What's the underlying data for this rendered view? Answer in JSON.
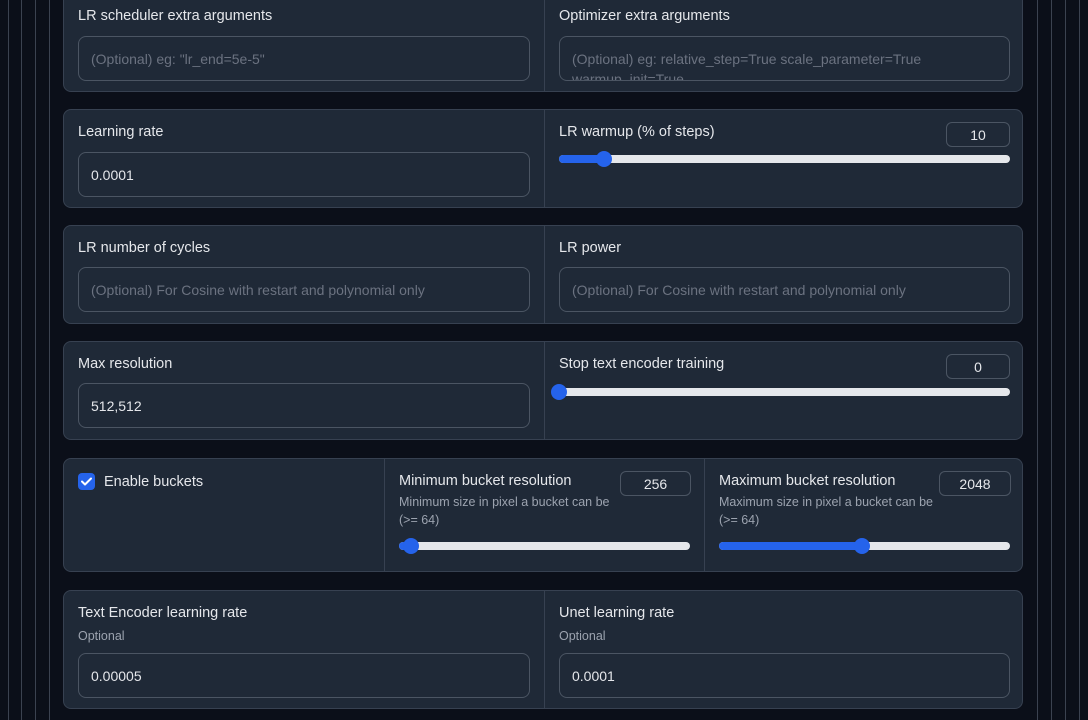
{
  "scheduler_row": {
    "lr_scheduler_args_label": "LR scheduler extra arguments",
    "lr_scheduler_args_placeholder": "(Optional) eg: \"lr_end=5e-5\"",
    "optimizer_args_label": "Optimizer extra arguments",
    "optimizer_args_placeholder": "(Optional) eg: relative_step=True scale_parameter=True warmup_init=True"
  },
  "lr_row": {
    "learning_rate_label": "Learning rate",
    "learning_rate_value": "0.0001",
    "lr_warmup_label": "LR warmup (% of steps)",
    "lr_warmup_value": "10",
    "lr_warmup_fraction": 0.1
  },
  "cycles_row": {
    "lr_cycles_label": "LR number of cycles",
    "lr_cycles_placeholder": "(Optional) For Cosine with restart and polynomial only",
    "lr_power_label": "LR power",
    "lr_power_placeholder": "(Optional) For Cosine with restart and polynomial only"
  },
  "resolution_row": {
    "max_resolution_label": "Max resolution",
    "max_resolution_value": "512,512",
    "stop_text_encoder_label": "Stop text encoder training",
    "stop_text_encoder_value": "0",
    "stop_text_encoder_fraction": 0.0
  },
  "bucket_row": {
    "enable_buckets_label": "Enable buckets",
    "enable_buckets_checked": true,
    "min_bucket_label": "Minimum bucket resolution",
    "min_bucket_info": "Minimum size in pixel a bucket can be (>= 64)",
    "min_bucket_value": "256",
    "min_bucket_fraction": 0.04,
    "max_bucket_label": "Maximum bucket resolution",
    "max_bucket_info": "Maximum size in pixel a bucket can be (>= 64)",
    "max_bucket_value": "2048",
    "max_bucket_fraction": 0.49
  },
  "encoder_row": {
    "text_encoder_lr_label": "Text Encoder learning rate",
    "text_encoder_lr_info": "Optional",
    "text_encoder_lr_value": "0.00005",
    "unet_lr_label": "Unet learning rate",
    "unet_lr_info": "Optional",
    "unet_lr_value": "0.0001"
  },
  "colors": {
    "background": "#0b0f19",
    "panel": "#1f2937",
    "accent": "#2563eb",
    "border": "#374151"
  }
}
